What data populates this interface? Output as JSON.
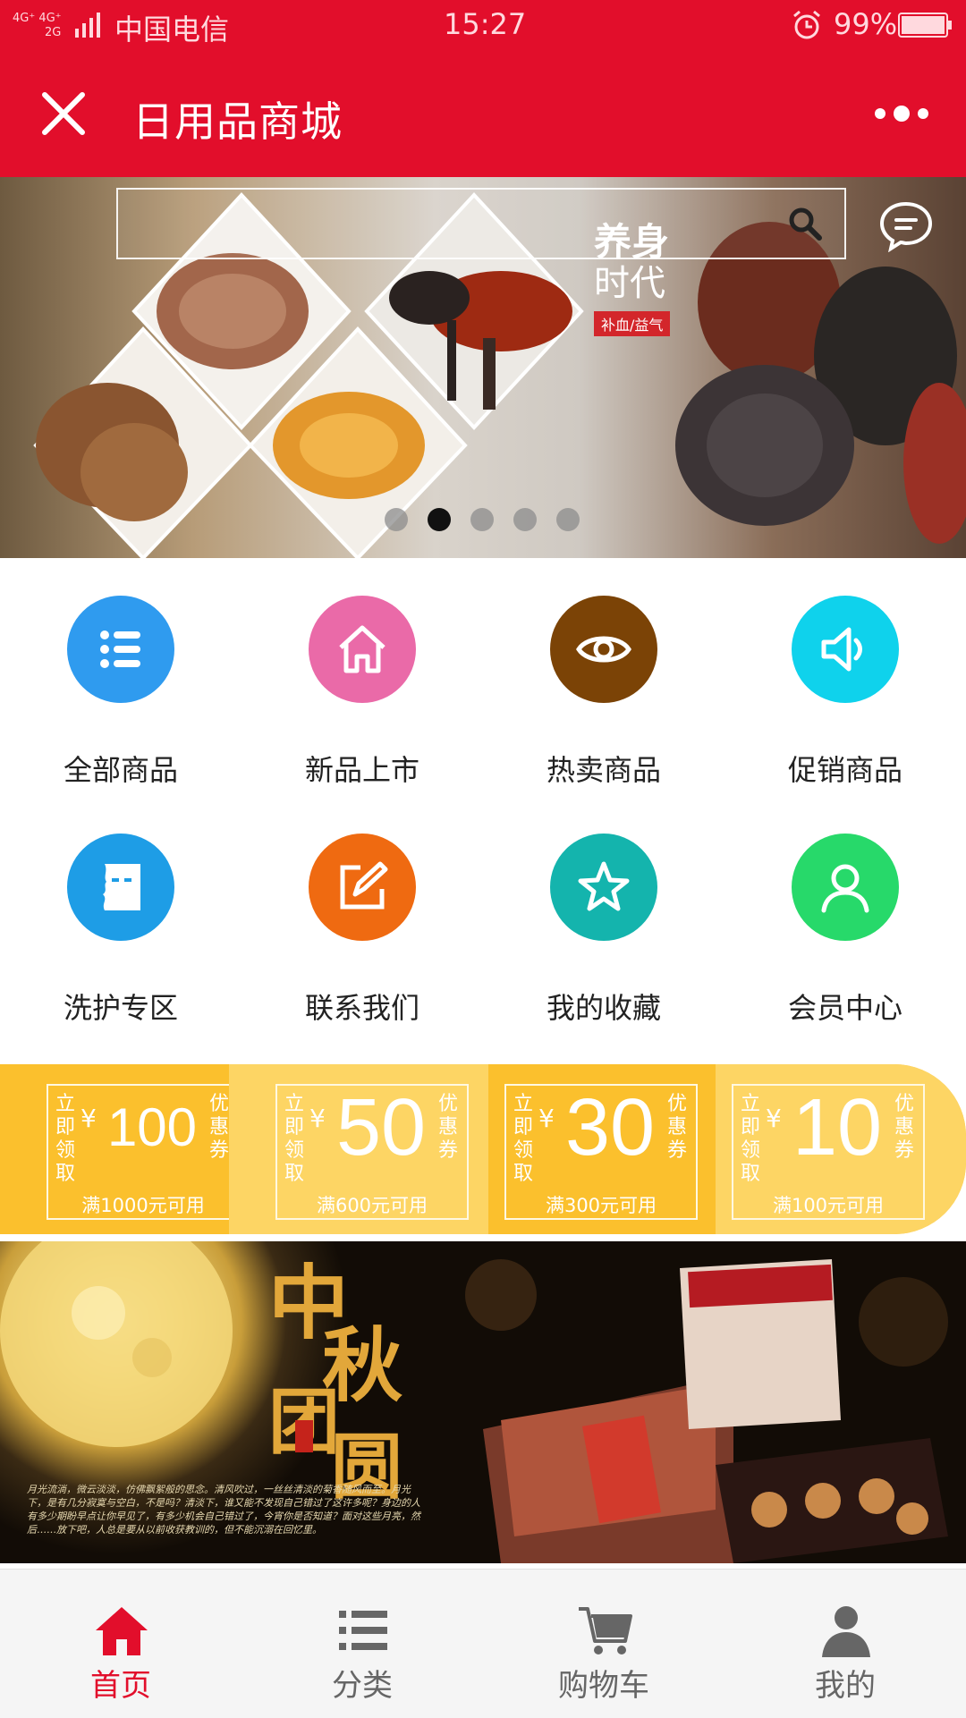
{
  "status_bar": {
    "signal_text": "4G⁺ 4G⁺ 2G",
    "carrier": "中国电信",
    "time": "15:27",
    "battery": "99%"
  },
  "header": {
    "title": "日用品商城"
  },
  "banner": {
    "line1": "养身",
    "line2": "时代",
    "tag": "补血/益气",
    "active_slide": 2,
    "slide_count": 5
  },
  "grid": [
    {
      "label": "全部商品",
      "icon": "list-icon",
      "color": "#2f9bef"
    },
    {
      "label": "新品上市",
      "icon": "home-icon",
      "color": "#ea6aa8"
    },
    {
      "label": "热卖商品",
      "icon": "eye-icon",
      "color": "#7b4306"
    },
    {
      "label": "促销商品",
      "icon": "speaker-icon",
      "color": "#0fd2ec"
    },
    {
      "label": "洗护专区",
      "icon": "mask-icon",
      "color": "#1e9de6"
    },
    {
      "label": "联系我们",
      "icon": "edit-icon",
      "color": "#ef6a11"
    },
    {
      "label": "我的收藏",
      "icon": "star-icon",
      "color": "#14b4ad"
    },
    {
      "label": "会员中心",
      "icon": "user-icon",
      "color": "#27d96a"
    }
  ],
  "coupons": [
    {
      "left": "立即领取",
      "yen": "¥",
      "amount": "100",
      "right": "优惠券",
      "condition": "满1000元可用"
    },
    {
      "left": "立即领取",
      "yen": "¥",
      "amount": "50",
      "right": "优惠券",
      "condition": "满600元可用"
    },
    {
      "left": "立即领取",
      "yen": "¥",
      "amount": "30",
      "right": "优惠券",
      "condition": "满300元可用"
    },
    {
      "left": "立即领取",
      "yen": "¥",
      "amount": "10",
      "right": "优惠券",
      "condition": "满100元可用"
    }
  ],
  "ad": {
    "title": "中秋团圆",
    "brand": "中秋",
    "caption": "月光流淌，微云淡淡，仿佛飘絮般的思念。清风吹过，一丝丝清淡的菊香随风而至。月光下，是有几分寂寞与空白，不是吗？清淡下，谁又能不发现自己错过了这许多呢？身边的人有多少期盼早点让你早见了，有多少机会自己错过了，今宵你是否知道？面对这些月亮，然后……放下吧，人总是要从以前收获教训的，但不能沉溺在回忆里。"
  },
  "bottom_nav": [
    {
      "label": "首页",
      "icon": "home-icon",
      "active": true
    },
    {
      "label": "分类",
      "icon": "list-icon",
      "active": false
    },
    {
      "label": "购物车",
      "icon": "cart-icon",
      "active": false
    },
    {
      "label": "我的",
      "icon": "user-icon",
      "active": false
    }
  ],
  "colors": {
    "brand_red": "#e20e2b",
    "coupon_yellow": "#fbc02d"
  }
}
